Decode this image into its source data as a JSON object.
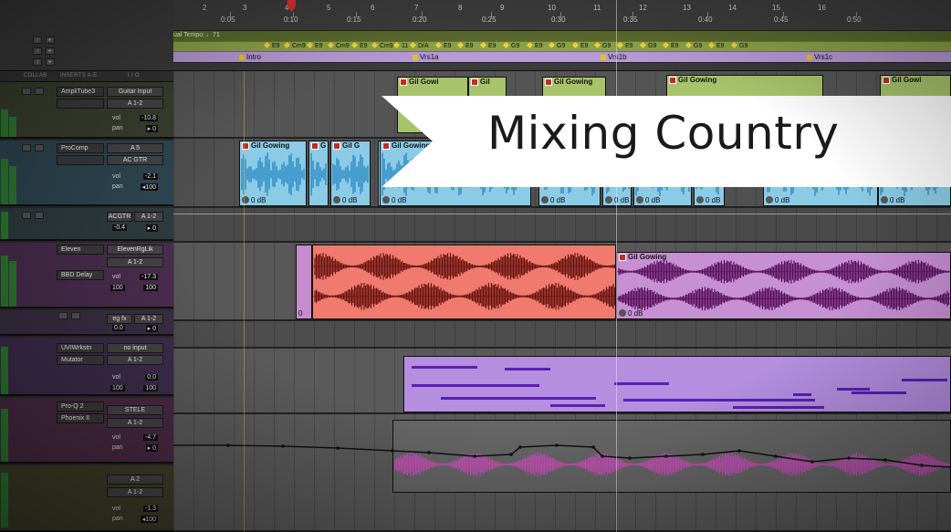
{
  "banner": {
    "title": "Mixing Country"
  },
  "ruler": {
    "bars": [
      "2",
      "3",
      "4",
      "5",
      "6",
      "7",
      "8",
      "9",
      "10",
      "11",
      "12",
      "13",
      "14",
      "15",
      "16"
    ],
    "times": [
      "0:05",
      "0:10",
      "0:15",
      "0:20",
      "0:25",
      "0:30",
      "0:35",
      "0:40",
      "0:45",
      "0:50"
    ]
  },
  "tempo_label": "ual Tempo: ♩71",
  "chords": [
    "E9",
    "Cm9",
    "E9",
    "Cm9",
    "E9",
    "Cm9",
    "11",
    "D/A",
    "E9",
    "E9",
    "E9",
    "G9",
    "E9",
    "G9",
    "E9",
    "G9",
    "E9",
    "G9",
    "E9",
    "G9",
    "E9",
    "G9"
  ],
  "markers": [
    "Intro",
    "Vrs1a",
    "Vrs1b",
    "Vrs1c"
  ],
  "column_headers": {
    "collab": "COLLAB",
    "inserts": "INSERTS A-E",
    "io": "I / O"
  },
  "tracks": [
    {
      "inserts": [
        "AmpliTube3"
      ],
      "io_input": "Guitar Input",
      "io_output": "A 1-2",
      "vol": "-10.8",
      "pan": "0",
      "pan_dir": "▸",
      "color": "#9fbf5a",
      "clips": [
        {
          "name": "Gil Gowi",
          "gain": ""
        },
        {
          "name": "Gil",
          "gain": ""
        },
        {
          "name": "Gil Gowing",
          "gain": ""
        },
        {
          "name": "Gil Gowing",
          "gain": ""
        },
        {
          "name": "Gil Gowi",
          "gain": ""
        }
      ]
    },
    {
      "inserts": [
        "ProComp"
      ],
      "io_input": "A 5",
      "io_output": "AC GTR",
      "vol": "-2.1",
      "pan": "100",
      "pan_dir": "◂",
      "color": "#7ec3e3",
      "clips": [
        {
          "name": "Gil Gowing",
          "gain": "0 dB"
        },
        {
          "name": "G",
          "gain": ""
        },
        {
          "name": "Gil G",
          "gain": "0 dB"
        },
        {
          "name": "Gil G",
          "gain": "0 dB"
        },
        {
          "name": "Gil Gowing",
          "gain": "0 dB"
        },
        {
          "name": "",
          "gain": "0 dB"
        },
        {
          "name": "",
          "gain": "0 dB"
        },
        {
          "name": "",
          "gain": "0 dB"
        },
        {
          "name": "",
          "gain": "0 dB"
        },
        {
          "name": "",
          "gain": "0 dB"
        },
        {
          "name": "",
          "gain": "0 dB"
        }
      ]
    },
    {
      "io_input": "ACGTR",
      "io_output": "A 1-2",
      "vol": "-0.4",
      "pan": "0",
      "pan_dir": "▸"
    },
    {
      "inserts": [
        "Eleven",
        "BBD Delay"
      ],
      "io_input": "ElevenRgLik",
      "io_output": "A 1-2",
      "vol": "-17.3",
      "pan_l": "100",
      "pan_r": "100",
      "color": "#c87cd1",
      "clips": [
        {
          "name": "",
          "gain": "0"
        },
        {
          "name": "Gil Gowing",
          "gain": "0 dB"
        }
      ]
    },
    {
      "io_input": "eg fx",
      "io_output": "A 1-2",
      "vol": "0.0",
      "pan": "0",
      "pan_dir": "▸"
    },
    {
      "inserts": [
        "UVIWrkstn",
        "Mutator"
      ],
      "io_input": "no input",
      "io_output": "A 1-2",
      "vol": "0.0",
      "pan_l": "100",
      "pan_r": "100",
      "color": "#a86fd0"
    },
    {
      "inserts": [
        "Pro-Q 2",
        "Phoenix II"
      ],
      "io_input": "STELE",
      "io_output": "A 1-2",
      "vol": "-4.7",
      "pan": "0",
      "pan_dir": "▸",
      "color": "#c86fbd"
    },
    {
      "io_input": "A 2",
      "io_output": "A 1-2",
      "vol": "-1.3",
      "pan": "100",
      "pan_dir": "◂"
    }
  ]
}
